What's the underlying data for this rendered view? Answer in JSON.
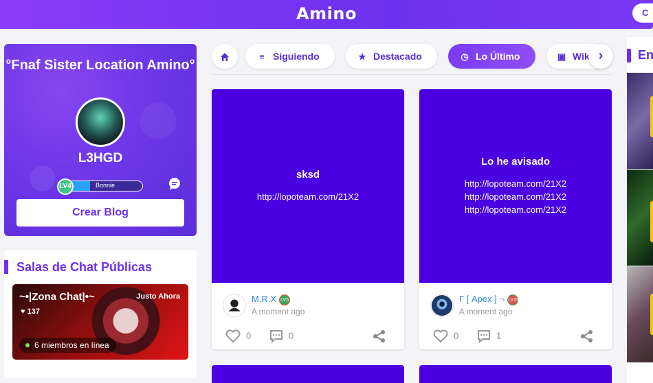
{
  "header": {
    "logo": "Amino",
    "right_pill": "C"
  },
  "profile": {
    "community_name": "°Fnaf Sister Location Amino°",
    "username": "L3HGD",
    "level": "LV4",
    "level_title": "Bonnie",
    "level_progress": 0.3,
    "create_blog": "Crear Blog"
  },
  "chat_rooms": {
    "title": "Salas de Chat Públicas",
    "rooms": [
      {
        "name": "~•|Zona Chat|•~",
        "time": "Justo Ahora",
        "members": "137",
        "online": "6 miembros en línea"
      }
    ]
  },
  "tabs": [
    {
      "label": "Siguiendo",
      "icon": "list-icon",
      "active": false
    },
    {
      "label": "Destacado",
      "icon": "star-icon",
      "active": false
    },
    {
      "label": "Lo Último",
      "icon": "clock-icon",
      "active": true
    },
    {
      "label": "Wiki",
      "icon": "wiki-icon",
      "active": false
    }
  ],
  "posts": [
    {
      "title": "sksd",
      "lines": [
        "http://lopoteam.com/21X2"
      ],
      "author": "M.R.X",
      "author_level": "LV5",
      "time": "A moment ago",
      "likes": "0",
      "comments": "0"
    },
    {
      "title": "Lo he avisado",
      "lines": [
        "http://lopoteam.com/21X2",
        "http://lopoteam.com/21X2",
        "http://lopoteam.com/21X2"
      ],
      "author": "Γ [ Apex ] ¬",
      "author_level": "LV15",
      "time": "A moment ago",
      "likes": "0",
      "comments": "1"
    }
  ],
  "right_column": {
    "title": "En"
  },
  "colors": {
    "brand": "#6c31f0",
    "cover": "#4a00e0",
    "link": "#2d87e2"
  }
}
